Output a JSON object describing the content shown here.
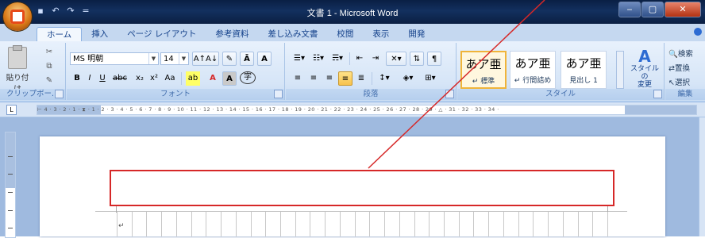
{
  "window": {
    "title": "文書 1 - Microsoft Word",
    "controls": {
      "minimize": "‒",
      "maximize": "▢",
      "close": "✕"
    }
  },
  "qat": {
    "save_icon": "save-icon",
    "undo_icon": "undo-icon",
    "redo_icon": "redo-icon",
    "customize": "="
  },
  "tabs": [
    {
      "label": "ホーム",
      "active": true
    },
    {
      "label": "挿入"
    },
    {
      "label": "ページ レイアウト"
    },
    {
      "label": "参考資料"
    },
    {
      "label": "差し込み文書"
    },
    {
      "label": "校閲"
    },
    {
      "label": "表示"
    },
    {
      "label": "開発"
    }
  ],
  "ribbon": {
    "clipboard": {
      "paste_label": "貼り付け",
      "group_label": "クリップボー..."
    },
    "font": {
      "font_name": "MS 明朝",
      "font_size": "14",
      "group_label": "フォント",
      "buttons": [
        "B",
        "I",
        "U",
        "abc",
        "x₂",
        "x²",
        "Aa",
        "A",
        "A"
      ]
    },
    "paragraph": {
      "group_label": "段落"
    },
    "styles": {
      "group_label": "スタイル",
      "items": [
        {
          "sample": "あア亜",
          "name": "↵ 標準",
          "selected": true
        },
        {
          "sample": "あア亜",
          "name": "↵ 行間詰め"
        },
        {
          "sample": "あア亜",
          "name": "見出し 1"
        }
      ],
      "change_styles_label_1": "スタイルの",
      "change_styles_label_2": "変更"
    },
    "editing": {
      "group_label": "編集",
      "find": "検索",
      "replace": "置換",
      "select": "選択"
    }
  },
  "ruler": {
    "text": "⊢ 4 ⋅ 3 ⋅ 2 ⋅ 1 ⋅ ⧗ ⋅ 1 ⋅ 2 ⋅ 3 ⋅ 4 ⋅ 5 ⋅ 6 ⋅ 7 ⋅ 8 ⋅ 9 ⋅ 10 ⋅ 11 ⋅ 12 ⋅ 13 ⋅ 14 ⋅ 15 ⋅ 16 ⋅ 17 ⋅ 18 ⋅ 19 ⋅ 20 ⋅ 21 ⋅ 22 ⋅ 23 ⋅ 24 ⋅ 25 ⋅ 26 ⋅ 27 ⋅ 28 ⋅ 29 ⋅ △ ⋅ 31 ⋅ 32 ⋅ 33 ⋅ 34 ⋅",
    "tab_selector": "L"
  },
  "document": {
    "paragraph_mark": "↵"
  },
  "colors": {
    "annotation": "#d62828",
    "accent": "#15428b"
  }
}
